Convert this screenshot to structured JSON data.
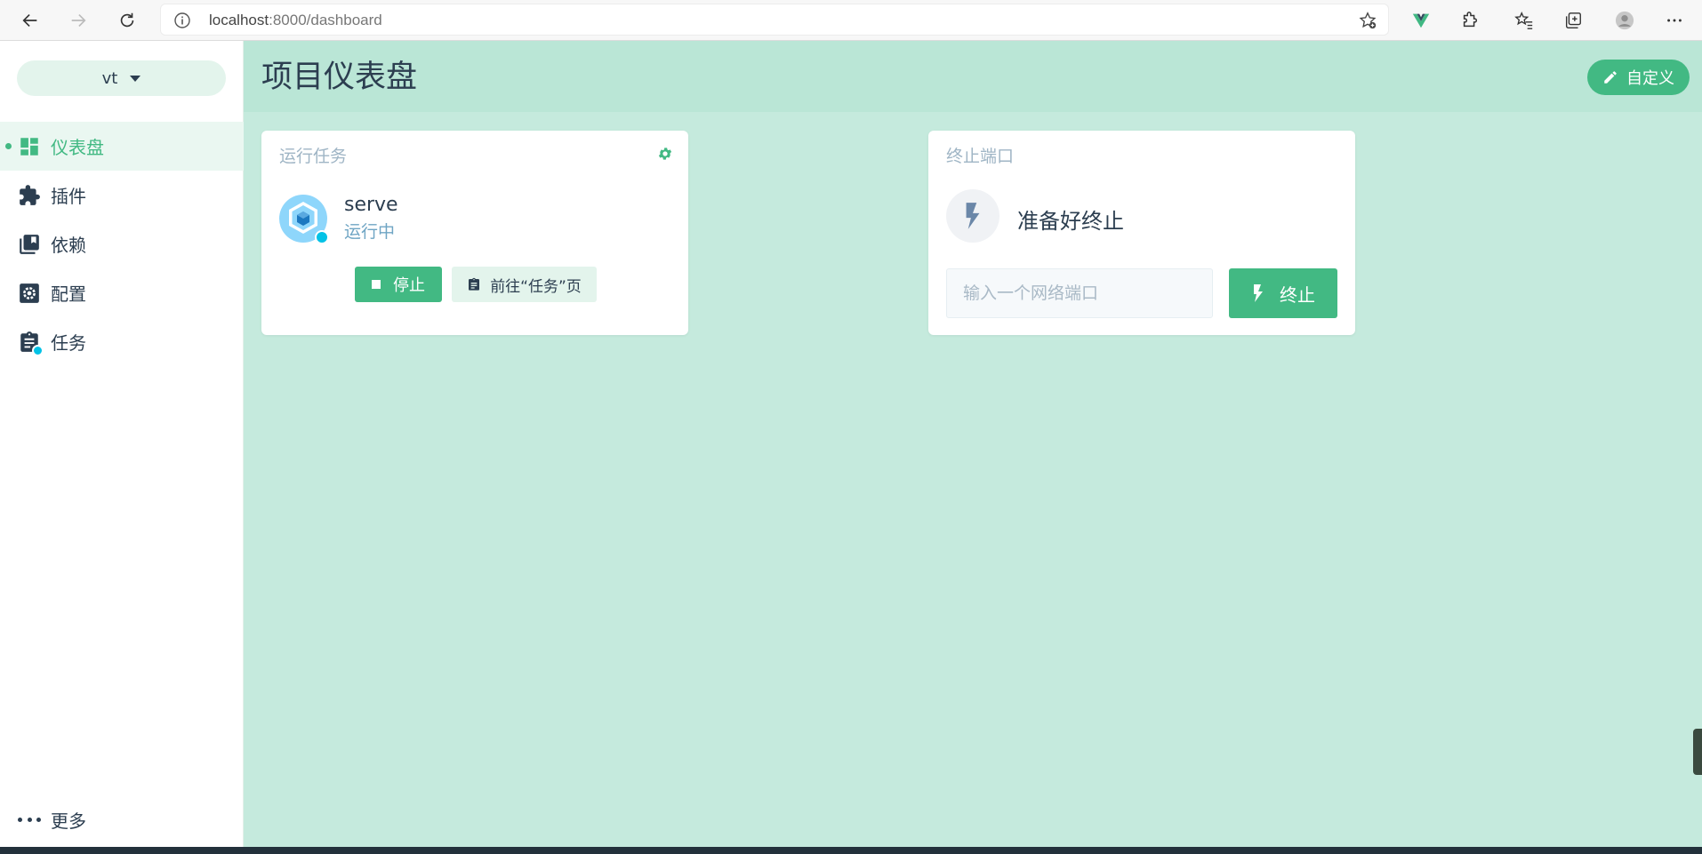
{
  "browser": {
    "url_host": "localhost",
    "url_rest": ":8000/dashboard"
  },
  "sidebar": {
    "project": "vt",
    "items": [
      {
        "label": "仪表盘",
        "icon": "dashboard-icon",
        "active": true
      },
      {
        "label": "插件",
        "icon": "puzzle-icon"
      },
      {
        "label": "依赖",
        "icon": "library-books-icon"
      },
      {
        "label": "配置",
        "icon": "settings-box-icon"
      },
      {
        "label": "任务",
        "icon": "clipboard-icon"
      }
    ],
    "more": "更多"
  },
  "header": {
    "title": "项目仪表盘",
    "customize": "自定义"
  },
  "widgets": {
    "run_task": {
      "title": "运行任务",
      "task_name": "serve",
      "task_status": "运行中",
      "stop": "停止",
      "goto": "前往“任务”页"
    },
    "kill_port": {
      "title": "终止端口",
      "status": "准备好终止",
      "placeholder": "输入一个网络端口",
      "kill": "终止"
    }
  },
  "colors": {
    "accent": "#42b983",
    "main_bg": "#c5eadd",
    "header_bg": "#bae6d6",
    "running": "#03c2e6"
  }
}
